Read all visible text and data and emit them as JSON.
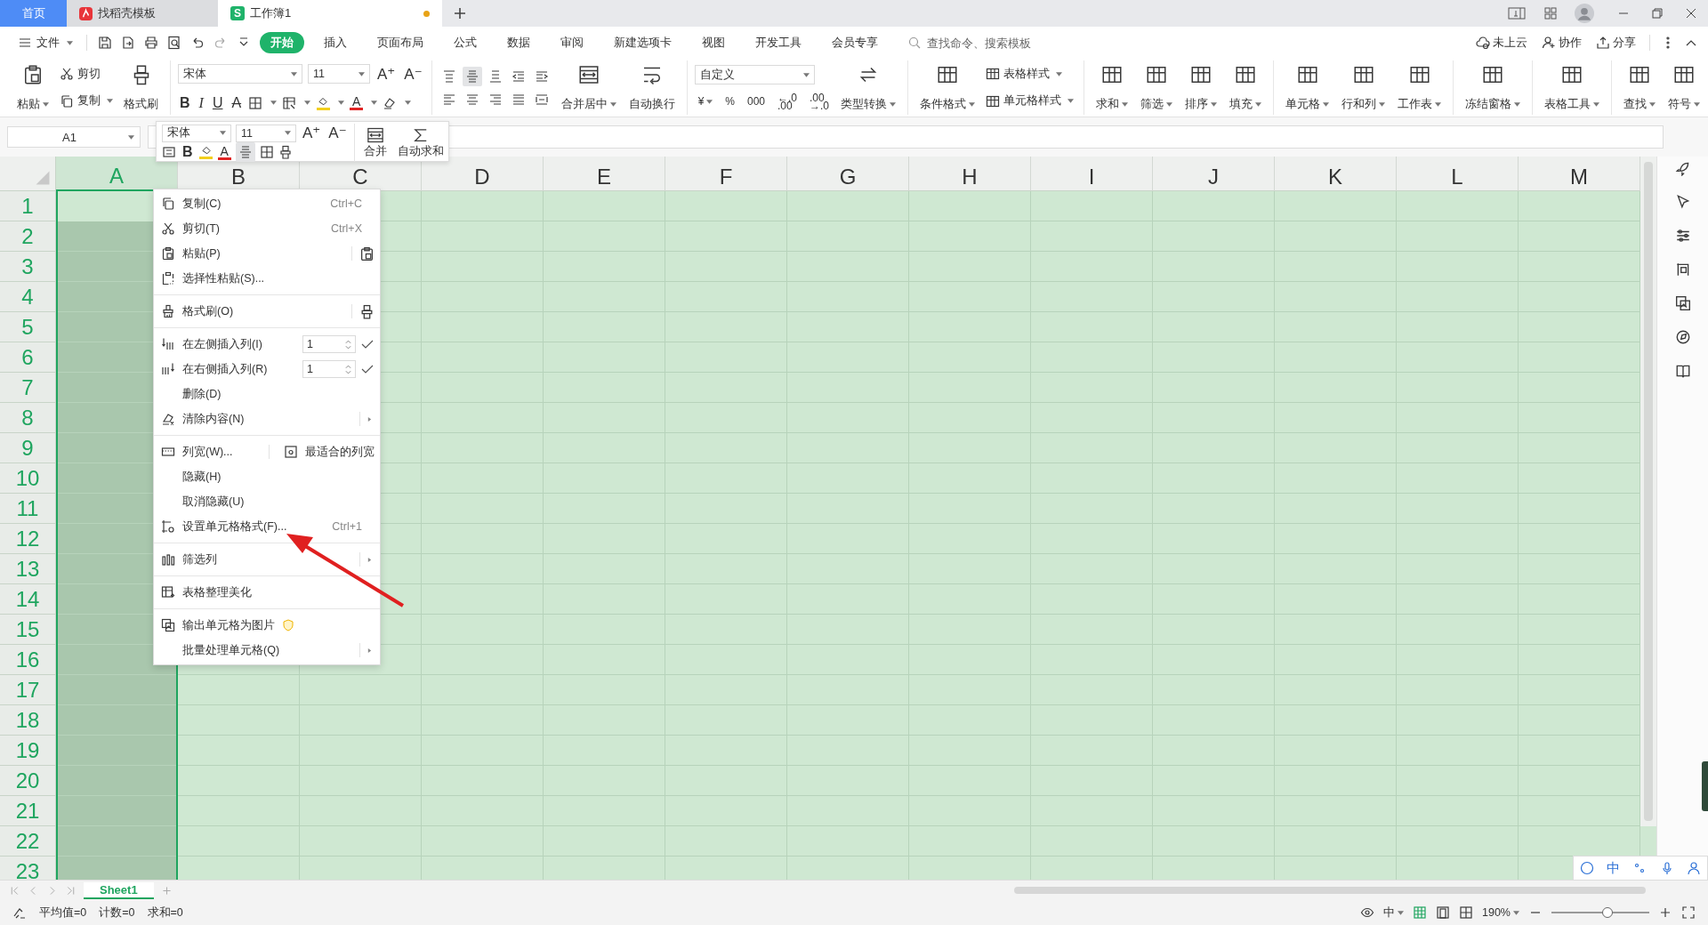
{
  "tabs": [
    {
      "label": "首页",
      "kind": "home",
      "selected": false,
      "unsaved": false
    },
    {
      "label": "找稻壳模板",
      "kind": "template",
      "selected": false,
      "unsaved": false
    },
    {
      "label": "工作簿1",
      "kind": "workbook",
      "selected": true,
      "unsaved": true,
      "logo_letter": "S"
    }
  ],
  "menu": {
    "file": "文件",
    "tabs": [
      {
        "label": "开始",
        "selected": true
      },
      {
        "label": "插入",
        "selected": false
      },
      {
        "label": "页面布局",
        "selected": false
      },
      {
        "label": "公式",
        "selected": false
      },
      {
        "label": "数据",
        "selected": false
      },
      {
        "label": "审阅",
        "selected": false
      },
      {
        "label": "新建选项卡",
        "selected": false
      },
      {
        "label": "视图",
        "selected": false
      },
      {
        "label": "开发工具",
        "selected": false
      },
      {
        "label": "会员专享",
        "selected": false
      }
    ],
    "search": {
      "placeholder": "查找命令、搜索模板"
    },
    "actions": [
      "未上云",
      "协作",
      "分享"
    ]
  },
  "ribbon": {
    "clipboard": {
      "paste": "粘贴",
      "cut": "剪切",
      "copy": "复制",
      "painter": "格式刷"
    },
    "font": {
      "name": "宋体",
      "size": "11",
      "grow": "A⁺",
      "shrink": "A⁻",
      "bold": "B",
      "italic": "I",
      "underline": "U",
      "strike": "A",
      "color_letter": "A"
    },
    "align": {
      "buttons": [
        {
          "selected": false
        },
        {
          "selected": true
        },
        {
          "selected": false
        },
        {
          "selected": false
        },
        {
          "selected": false
        },
        {
          "selected": false
        },
        {
          "selected": false
        },
        {
          "selected": false
        },
        {
          "selected": false
        },
        {
          "selected": false
        }
      ],
      "merge": "合并居中",
      "wrap": "自动换行"
    },
    "number": {
      "format": "自定义",
      "symbols": [
        {
          "text": "¥",
          "caret": true
        },
        {
          "text": "%",
          "caret": false
        },
        {
          "text": "000",
          "caret": false
        },
        {
          "text": "←.0\n.00",
          "caret": false
        },
        {
          "text": ".00\n→.0",
          "caret": false
        }
      ],
      "convert": "类型转换"
    },
    "groups": [
      [
        {
          "kind": "big",
          "label": "条件格式",
          "caret": true
        },
        {
          "kind": "stack",
          "items": [
            {
              "label": "表格样式",
              "caret": true
            },
            {
              "label": "单元格样式",
              "caret": true
            }
          ]
        }
      ],
      [
        {
          "kind": "big",
          "label": "求和",
          "caret": true
        },
        {
          "kind": "big",
          "label": "筛选",
          "caret": true
        },
        {
          "kind": "big",
          "label": "排序",
          "caret": true
        },
        {
          "kind": "big",
          "label": "填充",
          "caret": true
        }
      ],
      [
        {
          "kind": "big",
          "label": "单元格",
          "caret": true
        },
        {
          "kind": "big",
          "label": "行和列",
          "caret": true
        },
        {
          "kind": "big",
          "label": "工作表",
          "caret": true
        }
      ],
      [
        {
          "kind": "big",
          "label": "冻结窗格",
          "caret": true
        }
      ],
      [
        {
          "kind": "big",
          "label": "表格工具",
          "caret": true
        }
      ],
      [
        {
          "kind": "big",
          "label": "查找",
          "caret": true
        },
        {
          "kind": "big",
          "label": "符号",
          "caret": true
        }
      ]
    ]
  },
  "name_box": "A1",
  "mini_toolbar": {
    "font": "宋体",
    "size": "11",
    "grow": "A⁺",
    "shrink": "A⁻",
    "bold": "B",
    "color_letter": "A",
    "merge": "合并",
    "autosum": "自动求和"
  },
  "grid": {
    "columns": [
      {
        "label": "A",
        "selected": true
      },
      {
        "label": "B",
        "selected": false
      },
      {
        "label": "C",
        "selected": false
      },
      {
        "label": "D",
        "selected": false
      },
      {
        "label": "E",
        "selected": false
      },
      {
        "label": "F",
        "selected": false
      },
      {
        "label": "G",
        "selected": false
      },
      {
        "label": "H",
        "selected": false
      },
      {
        "label": "I",
        "selected": false
      },
      {
        "label": "J",
        "selected": false
      },
      {
        "label": "K",
        "selected": false
      },
      {
        "label": "L",
        "selected": false
      },
      {
        "label": "M",
        "selected": false
      }
    ],
    "rows": [
      "1",
      "2",
      "3",
      "4",
      "5",
      "6",
      "7",
      "8",
      "9",
      "10",
      "11",
      "12",
      "13",
      "14",
      "15",
      "16",
      "17",
      "18",
      "19",
      "20",
      "21",
      "22",
      "23"
    ]
  },
  "context_menu": {
    "items": [
      {
        "kind": "item",
        "label": "复制(C)",
        "icon": true,
        "shortcut": "Ctrl+C",
        "separator_before": false
      },
      {
        "kind": "item",
        "label": "剪切(T)",
        "icon": true,
        "shortcut": "Ctrl+X",
        "separator_before": false
      },
      {
        "kind": "item",
        "label": "粘贴(P)",
        "icon": true,
        "side_icon": true,
        "separator_before": false
      },
      {
        "kind": "item",
        "label": "选择性粘贴(S)...",
        "icon": true,
        "separator_before": false
      },
      {
        "kind": "item",
        "label": "格式刷(O)",
        "icon": true,
        "side_icon": true,
        "separator_before": true
      },
      {
        "kind": "spinner",
        "label": "在左侧插入列(I)",
        "icon": true,
        "value": "1",
        "separator_before": true
      },
      {
        "kind": "spinner",
        "label": "在右侧插入列(R)",
        "icon": true,
        "value": "1",
        "separator_before": false
      },
      {
        "kind": "item",
        "label": "删除(D)",
        "icon": false,
        "separator_before": false
      },
      {
        "kind": "item",
        "label": "清除内容(N)",
        "icon": true,
        "submenu": true,
        "separator_before": false
      },
      {
        "kind": "split",
        "label": "列宽(W)...",
        "icon": true,
        "side_label": "最适合的列宽",
        "separator_before": true
      },
      {
        "kind": "item",
        "label": "隐藏(H)",
        "icon": false,
        "separator_before": false
      },
      {
        "kind": "item",
        "label": "取消隐藏(U)",
        "icon": false,
        "separator_before": false
      },
      {
        "kind": "item",
        "label": "设置单元格格式(F)...",
        "icon": true,
        "shortcut": "Ctrl+1",
        "separator_before": false
      },
      {
        "kind": "item",
        "label": "筛选列",
        "icon": true,
        "submenu": true,
        "separator_before": true
      },
      {
        "kind": "item",
        "label": "表格整理美化",
        "icon": true,
        "separator_before": true
      },
      {
        "kind": "item",
        "label": "输出单元格为图片",
        "icon": true,
        "premium": true,
        "separator_before": true
      },
      {
        "kind": "item",
        "label": "批量处理单元格(Q)",
        "icon": false,
        "submenu": true,
        "separator_before": false
      }
    ]
  },
  "sheets": [
    {
      "label": "Sheet1",
      "selected": true
    }
  ],
  "status_bar": {
    "stats": [
      "平均值=0",
      "计数=0",
      "求和=0"
    ],
    "input_mode": "中",
    "zoom": {
      "reading": "190%",
      "level": 0.57
    }
  },
  "ime": {
    "mode": "中"
  }
}
